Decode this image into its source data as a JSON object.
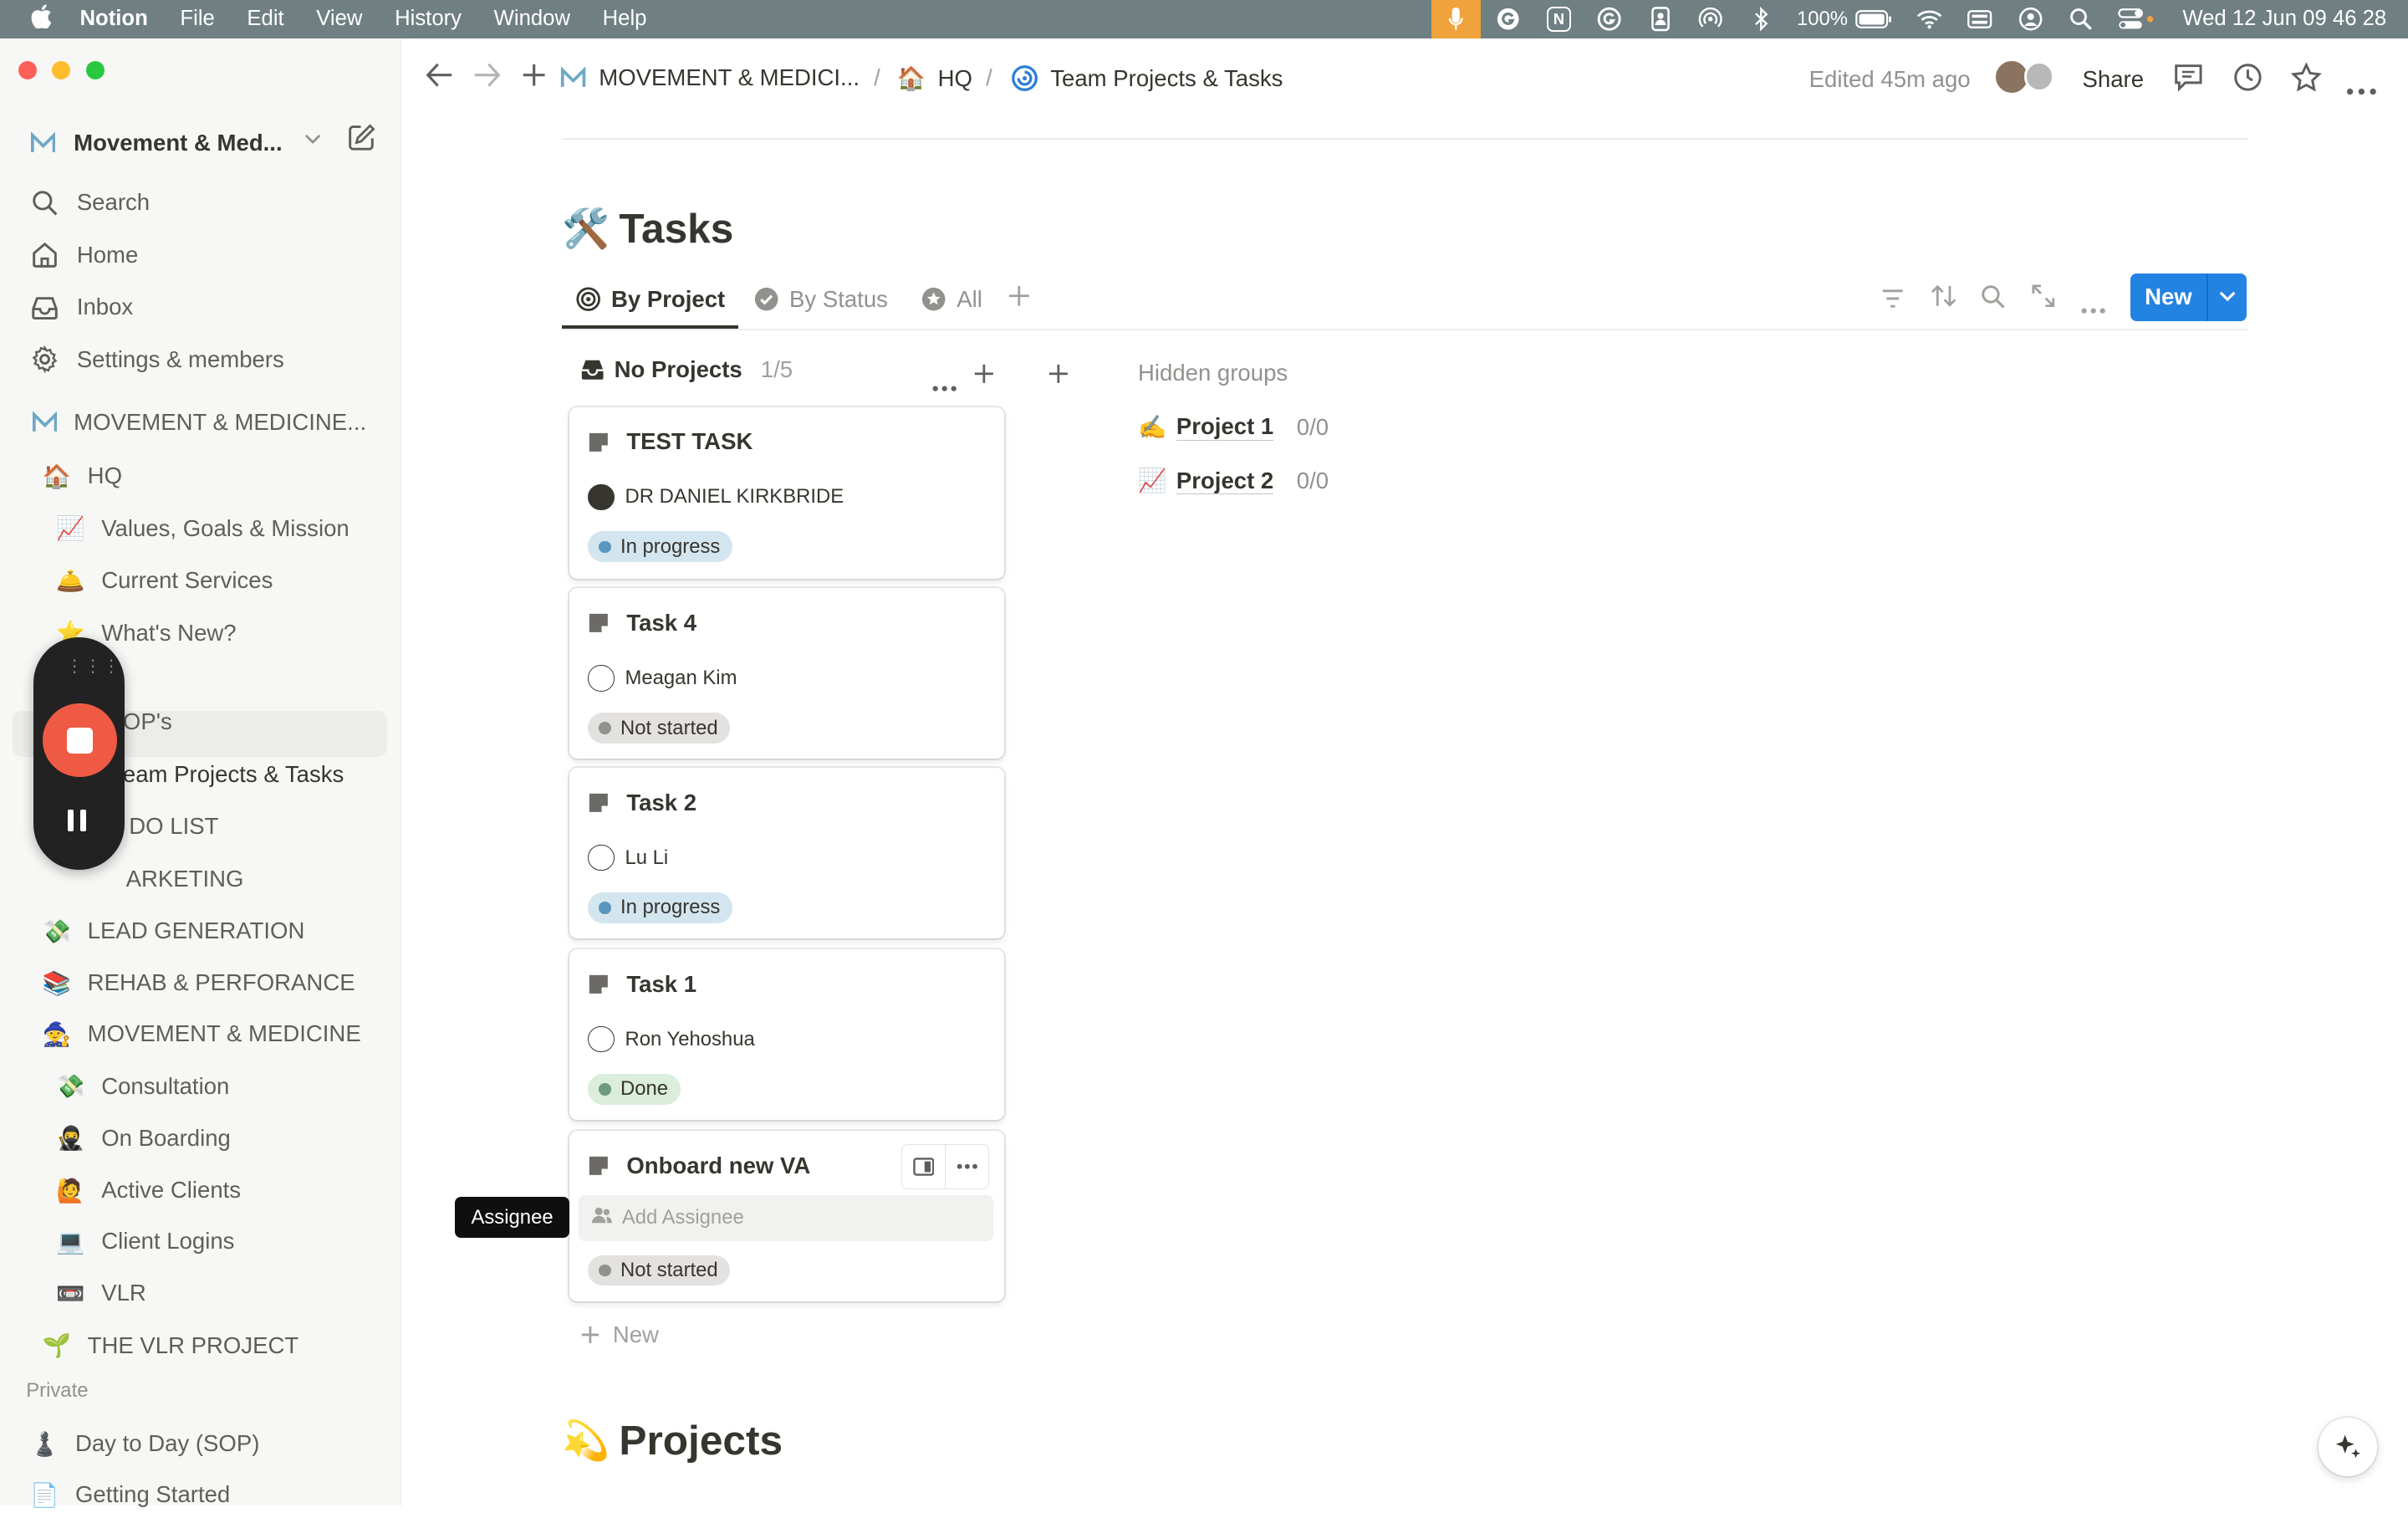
{
  "menubar": {
    "apple_icon": "apple-icon",
    "app": "Notion",
    "menus": [
      "File",
      "Edit",
      "View",
      "History",
      "Window",
      "Help"
    ],
    "notion_badge": "N",
    "battery": "100%",
    "clock": "Wed 12 Jun  09 46 28"
  },
  "sidebar": {
    "workspace": "Movement & Med...",
    "workspace_logo": "M",
    "nav": [
      {
        "label": "Search",
        "icon": "search-icon"
      },
      {
        "label": "Home",
        "icon": "home-icon"
      },
      {
        "label": "Inbox",
        "icon": "inbox-icon"
      },
      {
        "label": "Settings & members",
        "icon": "gear-icon"
      }
    ],
    "teamspace": "MOVEMENT & MEDICINE...",
    "pages": [
      {
        "emoji": "🏠",
        "label": "HQ"
      },
      {
        "emoji": "📈",
        "label": "Values, Goals & Mission"
      },
      {
        "emoji": "🛎️",
        "label": "Current Services"
      },
      {
        "emoji": "⭐",
        "label": "What's New?"
      },
      {
        "emoji": "",
        "label": "OP's"
      },
      {
        "emoji": "",
        "label": "eam Projects & Tasks"
      },
      {
        "emoji": "",
        "label": "DO LIST"
      },
      {
        "emoji": "",
        "label": "ARKETING"
      },
      {
        "emoji": "💸",
        "label": "LEAD GENERATION"
      },
      {
        "emoji": "📚",
        "label": "REHAB & PERFORANCE"
      },
      {
        "emoji": "🧙",
        "label": "MOVEMENT & MEDICINE"
      },
      {
        "emoji": "💸",
        "label": "Consultation"
      },
      {
        "emoji": "🥷",
        "label": "On Boarding"
      },
      {
        "emoji": "🙋",
        "label": "Active Clients"
      },
      {
        "emoji": "💻",
        "label": "Client Logins"
      },
      {
        "emoji": "📼",
        "label": "VLR"
      },
      {
        "emoji": "🌱",
        "label": "THE VLR PROJECT"
      }
    ],
    "private_heading": "Private",
    "private_pages": [
      {
        "emoji": "♟️",
        "label": "Day to Day (SOP)"
      },
      {
        "emoji": "📄",
        "label": "Getting Started"
      }
    ]
  },
  "topbar": {
    "crumbs": [
      {
        "emoji": "Ⓜ",
        "label": "MOVEMENT & MEDICI..."
      },
      {
        "emoji": "🏠",
        "label": "HQ"
      },
      {
        "emoji": "🌀",
        "label": "Team Projects & Tasks"
      }
    ],
    "separator": "/",
    "edited": "Edited 45m ago",
    "share": "Share"
  },
  "main": {
    "title_emoji": "🛠️",
    "title": "Tasks",
    "tabs": [
      {
        "label": "By Project",
        "icon": "target-icon"
      },
      {
        "label": "By Status",
        "icon": "check-circle-icon"
      },
      {
        "label": "All",
        "icon": "star-circle-icon"
      }
    ],
    "new_label": "New",
    "group": {
      "name": "No Projects",
      "count": "1/5"
    },
    "cards": [
      {
        "title": "TEST TASK",
        "assignee": "DR DANIEL KIRKBRIDE",
        "status": "In progress"
      },
      {
        "title": "Task 4",
        "assignee": "Meagan Kim",
        "status": "Not started"
      },
      {
        "title": "Task 2",
        "assignee": "Lu Li",
        "status": "In progress"
      },
      {
        "title": "Task 1",
        "assignee": "Ron Yehoshua",
        "status": "Done"
      },
      {
        "title": "Onboard new VA",
        "assignee_placeholder": "Add Assignee",
        "status": "Not started"
      }
    ],
    "tooltip": "Assignee",
    "new_row": "New",
    "hidden_groups": "Hidden groups",
    "hidden": [
      {
        "emoji": "✍️",
        "label": "Project 1",
        "count": "0/0"
      },
      {
        "emoji": "📈",
        "label": "Project 2",
        "count": "0/0"
      }
    ],
    "projects_emoji": "💫",
    "projects_title": "Projects"
  },
  "colors": {
    "accent": "#2383e2",
    "menubar": "#6f7f82",
    "recording": "#ef5a45",
    "in_progress_bg": "#d3e5ef",
    "not_started_bg": "#e3e2e0",
    "done_bg": "#dbeddb"
  }
}
